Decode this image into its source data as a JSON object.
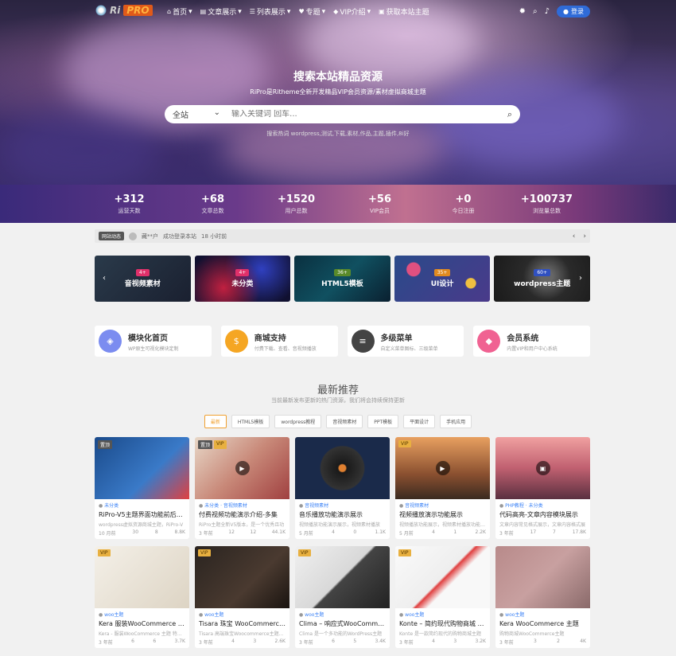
{
  "nav": {
    "logo_prefix": "Ri",
    "logo_text": "PRO",
    "menu": [
      {
        "label": "首页",
        "icon": "home-icon"
      },
      {
        "label": "文章展示",
        "icon": "document-icon"
      },
      {
        "label": "列表展示",
        "icon": "list-icon"
      },
      {
        "label": "专题",
        "icon": "heart-icon"
      },
      {
        "label": "VIP介绍",
        "icon": "diamond-icon"
      },
      {
        "label": "获取本站主题",
        "icon": "shopping-bag-icon"
      }
    ],
    "login_label": "登录"
  },
  "hero": {
    "title": "搜索本站精品资源",
    "subtitle": "RiPro是Ritheme全新开发精品VIP会员资源/素材虚拟商城主题",
    "search_scope": "全站",
    "search_placeholder": "输入关键词 回车...",
    "hot_words": "搜索热词 wordpress,测试,下载,素材,作品,主题,插件,8i好"
  },
  "stats": [
    {
      "num": "+312",
      "label": "运营天数"
    },
    {
      "num": "+68",
      "label": "文章总数"
    },
    {
      "num": "+1520",
      "label": "用户总数"
    },
    {
      "num": "+56",
      "label": "VIP会员"
    },
    {
      "num": "+0",
      "label": "今日注册"
    },
    {
      "num": "+100737",
      "label": "浏览量总数"
    }
  ],
  "notice": {
    "tag": "网站动态",
    "user": "藏**户",
    "action": "成功登录本站",
    "time": "18 小时前"
  },
  "categories": [
    {
      "count": "4+",
      "name": "音视频素材"
    },
    {
      "count": "4+",
      "name": "未分类"
    },
    {
      "count": "36+",
      "name": "HTML5模板"
    },
    {
      "count": "35+",
      "name": "UI设计"
    },
    {
      "count": "60+",
      "name": "wordpress主题"
    }
  ],
  "features": [
    {
      "title": "模块化首页",
      "sub": "WP原生可视化模块定制",
      "color": "#7b8cf0",
      "icon": "layers-icon"
    },
    {
      "title": "商城支持",
      "sub": "付费下载、查看、音视频播放",
      "color": "#f5a623",
      "icon": "shopping-bag-icon"
    },
    {
      "title": "多级菜单",
      "sub": "自定义菜单图标、三级菜单",
      "color": "#444444",
      "icon": "menu-icon"
    },
    {
      "title": "会员系统",
      "sub": "内置VIP和用户中心系统",
      "color": "#f06292",
      "icon": "diamond-icon"
    }
  ],
  "section": {
    "title": "最新推荐",
    "subtitle": "当前最新发布更新的热门资源，我们将会持续保持更新"
  },
  "tabs": [
    "最新",
    "HTML5模板",
    "wordpress教程",
    "音视频素材",
    "PPT模板",
    "平面设计",
    "手机应用"
  ],
  "cards": [
    {
      "badges": [
        "置顶"
      ],
      "cat": "未分类",
      "title": "RiPro-V5主题界面功能前后台...",
      "desc": "wordpress虚拟资源商城主题，RiPro-V",
      "meta": [
        "10 月前",
        "30",
        "8",
        "8.8K"
      ]
    },
    {
      "badges": [
        "置顶",
        "VIP"
      ],
      "cat": "未分类 · 音视频素材",
      "title": "付费视频功能演示介绍-多集",
      "desc": "RiPro主题全新V5版本，是一个优秀且功",
      "meta": [
        "3 年前",
        "12",
        "12",
        "44.1K"
      ]
    },
    {
      "badges": [],
      "cat": "音视频素材",
      "title": "音乐播放功能演示展示",
      "desc": "视频播放功能演示展示，视频素材播放",
      "meta": [
        "5 月前",
        "4",
        "0",
        "1.1K"
      ]
    },
    {
      "badges": [
        "VIP"
      ],
      "cat": "音视频素材",
      "title": "视频播放演示功能展示",
      "desc": "视频播放功能展示，视频素材播放功能展示",
      "meta": [
        "5 月前",
        "4",
        "1",
        "2.2K"
      ]
    },
    {
      "badges": [],
      "cat": "PHP教程 · 未分类",
      "title": "代码高亮-文章内容模块展示",
      "desc": "文章内容常见格式展示，文章内容格式展",
      "meta": [
        "3 年前",
        "17",
        "7",
        "17.8K"
      ]
    },
    {
      "badges": [
        "VIP"
      ],
      "cat": "woo主题",
      "title": "Kera 服装WooCommerce 主题",
      "desc": "Kera - 服装WooCommerce 主题 特点：",
      "meta": [
        "3 年前",
        "6",
        "6",
        "3.7K"
      ]
    },
    {
      "badges": [
        "VIP"
      ],
      "cat": "woo主题",
      "title": "Tisara 珠宝 WooCommerce ...",
      "desc": "Tisara 高端珠宝Woocommerce主题，使用",
      "meta": [
        "3 年前",
        "4",
        "3",
        "2.6K"
      ]
    },
    {
      "badges": [
        "VIP"
      ],
      "cat": "woo主题",
      "title": "Clima – 响应式WooCommerce...",
      "desc": "Clima 是一个多功能的WordPress主题",
      "meta": [
        "3 年前",
        "6",
        "5",
        "3.4K"
      ]
    },
    {
      "badges": [
        "VIP"
      ],
      "cat": "woo主题",
      "title": "Konte – 简约现代购物商城 WooCommerce...",
      "desc": "Konte 是一款简约现代的购物商城主题",
      "meta": [
        "3 年前",
        "4",
        "3",
        "3.2K"
      ]
    },
    {
      "badges": [],
      "cat": "woo主题",
      "title": "Kera WooCommerce 主题",
      "desc": "购物商城WooCommerce主题",
      "meta": [
        "3 年前",
        "3",
        "2",
        "4K"
      ]
    }
  ]
}
